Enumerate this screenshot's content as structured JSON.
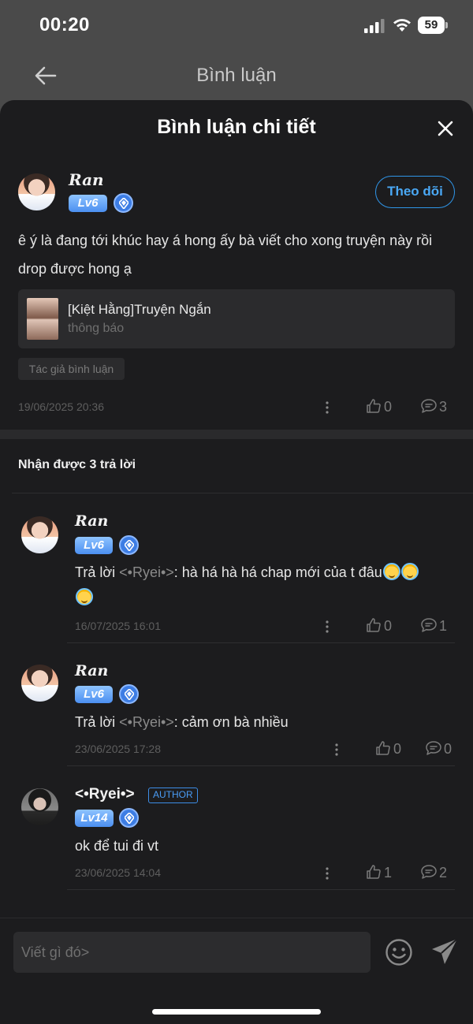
{
  "status_bar": {
    "time": "00:20",
    "battery": "59"
  },
  "page": {
    "title": "Bình luận"
  },
  "sheet": {
    "title": "Bình luận chi tiết"
  },
  "main_comment": {
    "username": "Ran",
    "level": "Lv6",
    "follow_label": "Theo dõi",
    "text": "ê ý là đang tới khúc hay á hong ấy bà viết cho xong truyện này rồi drop được hong ạ",
    "story": {
      "title": "[Kiệt Hằng]Truyện Ngắn",
      "subtitle": "thông báo"
    },
    "tag": "Tác giả bình luận",
    "date": "19/06/2025 20:36",
    "likes": "0",
    "replies": "3"
  },
  "replies_header": "Nhận được 3 trả lời",
  "replies": [
    {
      "username": "Ran",
      "level": "Lv6",
      "prefix": "Trả lời ",
      "mention": "<•Ryei•>",
      "text": ": hà há hà há chap mới của t đâu",
      "date": "16/07/2025 16:01",
      "likes": "0",
      "replies": "1"
    },
    {
      "username": "Ran",
      "level": "Lv6",
      "prefix": "Trả lời ",
      "mention": "<•Ryei•>",
      "text": ": cảm ơn bà nhiều",
      "date": "23/06/2025 17:28",
      "likes": "0",
      "replies": "0"
    },
    {
      "username": "<•Ryei•>",
      "level": "Lv14",
      "author_badge": "AUTHOR",
      "text": "ok để tui đi vt",
      "date": "23/06/2025 14:04",
      "likes": "1",
      "replies": "2"
    }
  ],
  "composer": {
    "placeholder": "Viết gì đó>"
  },
  "colors": {
    "accent": "#2f95e8",
    "sheet_bg": "#1c1c1e",
    "level_badge": "#4b8ff0"
  },
  "icons": [
    "back-arrow-icon",
    "close-icon",
    "diamond-icon",
    "more-vertical-icon",
    "thumbs-up-icon",
    "comment-bubble-icon",
    "smiley-icon",
    "send-icon"
  ]
}
